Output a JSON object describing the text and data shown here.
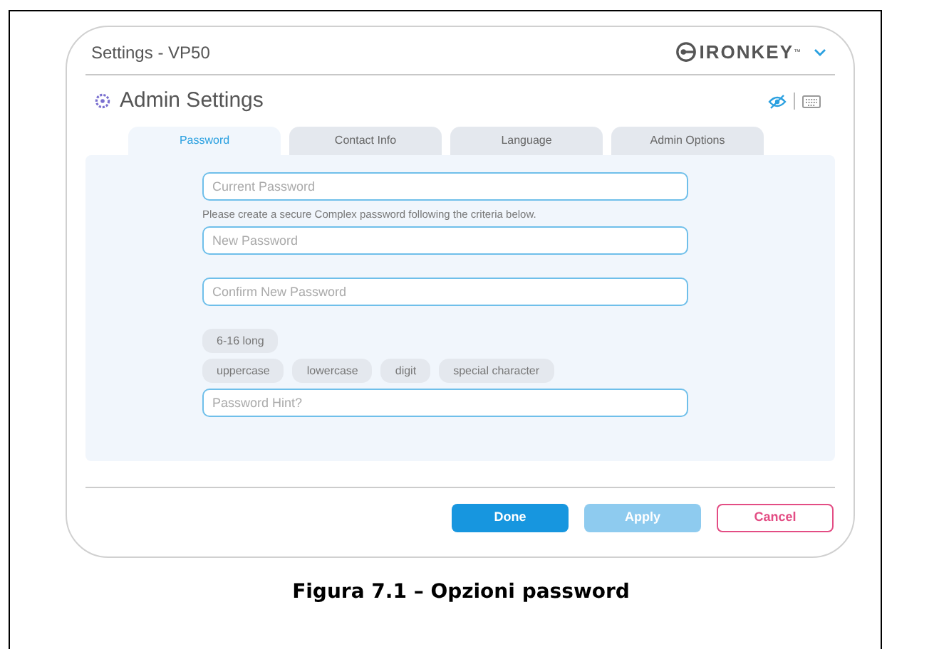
{
  "window": {
    "title": "Settings - VP50",
    "brand": "IRONKEY",
    "brand_mark": "™"
  },
  "section": {
    "title": "Admin Settings"
  },
  "tabs": [
    {
      "label": "Password",
      "selected": true
    },
    {
      "label": "Contact Info",
      "selected": false
    },
    {
      "label": "Language",
      "selected": false
    },
    {
      "label": "Admin Options",
      "selected": false
    }
  ],
  "fields": [
    {
      "kind": "input",
      "placeholder": "Current Password"
    },
    {
      "kind": "note",
      "text": "Please create a secure Complex password following the criteria below."
    },
    {
      "kind": "input",
      "placeholder": "New Password"
    },
    {
      "kind": "input",
      "placeholder": "Confirm New Password"
    },
    {
      "kind": "chips",
      "items": [
        "6-16 long"
      ]
    },
    {
      "kind": "chips",
      "items": [
        "uppercase",
        "lowercase",
        "digit",
        "special character"
      ]
    },
    {
      "kind": "input",
      "placeholder": "Password Hint?"
    }
  ],
  "buttons": [
    {
      "label": "Done",
      "kind": "primary",
      "disabled": false
    },
    {
      "label": "Apply",
      "kind": "primary",
      "disabled": true
    },
    {
      "label": "Cancel",
      "kind": "outline",
      "disabled": false
    }
  ],
  "caption": "Figura 7.1 – Opzioni password"
}
